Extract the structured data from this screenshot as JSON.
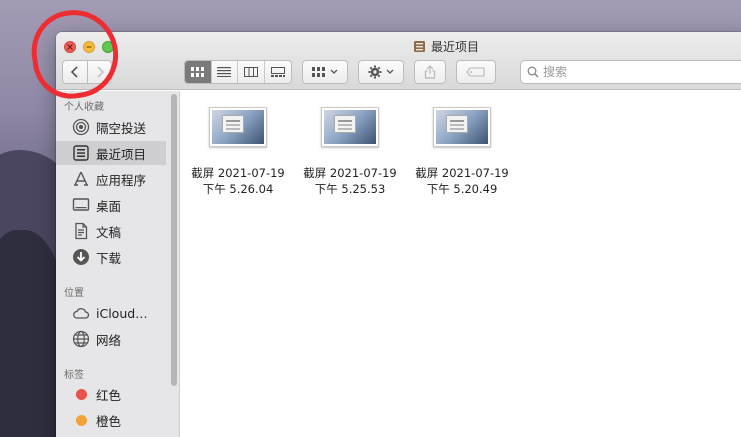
{
  "window": {
    "title": "最近项目"
  },
  "toolbar": {
    "search_placeholder": "搜索"
  },
  "sidebar": {
    "favorites_header": "个人收藏",
    "favorites": [
      {
        "label": "隔空投送",
        "icon": "airdrop-icon"
      },
      {
        "label": "最近项目",
        "icon": "recents-icon",
        "selected": true
      },
      {
        "label": "应用程序",
        "icon": "applications-icon"
      },
      {
        "label": "桌面",
        "icon": "desktop-icon"
      },
      {
        "label": "文稿",
        "icon": "documents-icon"
      },
      {
        "label": "下载",
        "icon": "downloads-icon"
      }
    ],
    "locations_header": "位置",
    "locations": [
      {
        "label": "iCloud…",
        "icon": "icloud-icon"
      },
      {
        "label": "网络",
        "icon": "network-icon"
      }
    ],
    "tags_header": "标签",
    "tags": [
      {
        "label": "红色",
        "color": "#e9524a"
      },
      {
        "label": "橙色",
        "color": "#f2a33a"
      }
    ]
  },
  "files": [
    {
      "line1": "截屏 2021-07-19",
      "line2": "下午 5.26.04"
    },
    {
      "line1": "截屏 2021-07-19",
      "line2": "下午 5.25.53"
    },
    {
      "line1": "截屏 2021-07-19",
      "line2": "下午 5.20.49"
    }
  ],
  "colors": {
    "annotation": "#ee2d33",
    "close": "#ec5f57",
    "minimize": "#f6bd3b",
    "maximize": "#5fc752"
  }
}
